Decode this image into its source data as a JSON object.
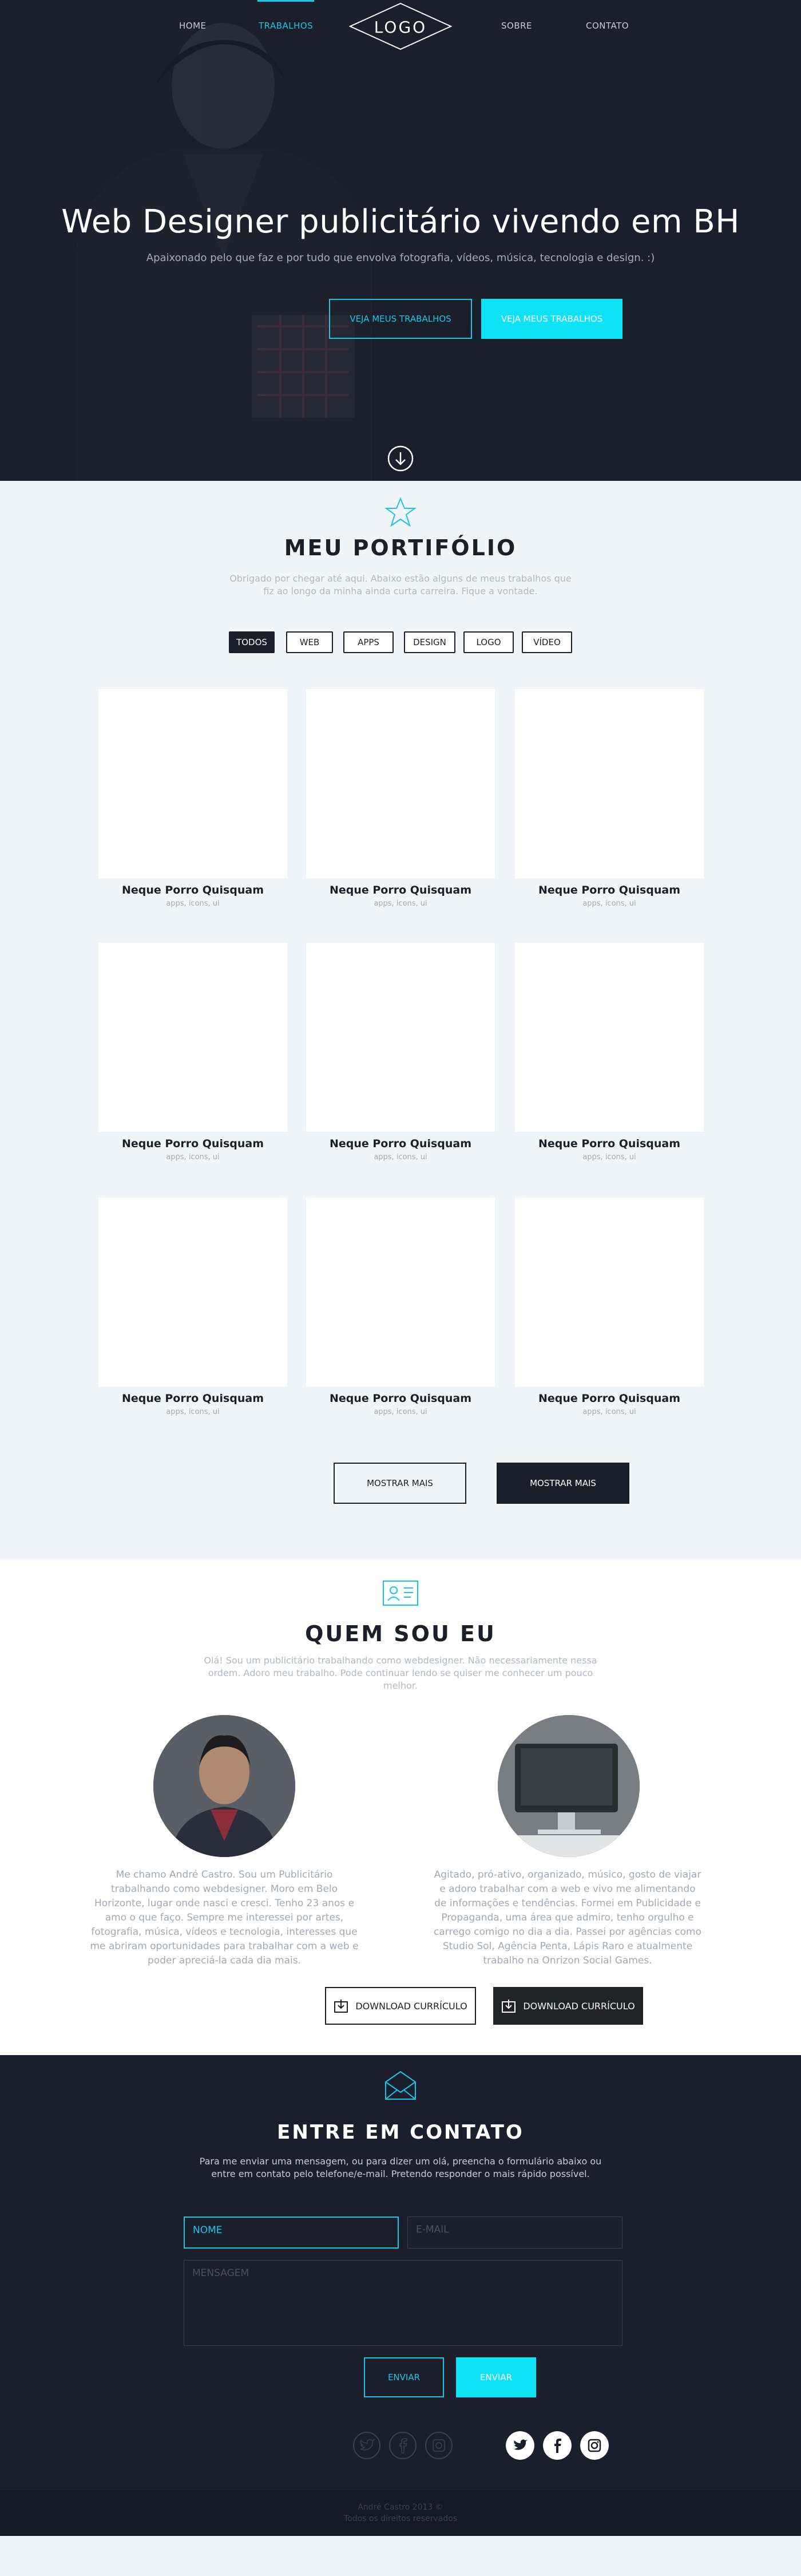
{
  "nav": {
    "items": [
      "HOME",
      "TRABALHOS",
      "SOBRE",
      "CONTATO"
    ],
    "logo": "LOGO"
  },
  "hero": {
    "title": "Web Designer publicitário vivendo em BH",
    "subtitle": "Apaixonado pelo que faz e por tudo que envolva fotografia, vídeos, música, tecnologia e design. :)",
    "button_outline": "VEJA MEUS TRABALHOS",
    "button_filled": "VEJA MEUS TRABALHOS"
  },
  "portfolio": {
    "title": "MEU PORTIFÓLIO",
    "subtitle": "Obrigado por chegar até aqui. Abaixo estão alguns de meus trabalhos que fiz ao longo da minha ainda curta carreira. Fique a vontade.",
    "filters": [
      "TODOS",
      "WEB",
      "APPS",
      "DESIGN",
      "LOGO",
      "VÍDEO"
    ],
    "items": [
      {
        "name": "Neque Porro Quisquam",
        "tags": "apps, icons, ui"
      },
      {
        "name": "Neque Porro Quisquam",
        "tags": "apps, icons, ui"
      },
      {
        "name": "Neque Porro Quisquam",
        "tags": "apps, icons, ui"
      },
      {
        "name": "Neque Porro Quisquam",
        "tags": "apps, icons, ui"
      },
      {
        "name": "Neque Porro Quisquam",
        "tags": "apps, icons, ui"
      },
      {
        "name": "Neque Porro Quisquam",
        "tags": "apps, icons, ui"
      },
      {
        "name": "Neque Porro Quisquam",
        "tags": "apps, icons, ui"
      },
      {
        "name": "Neque Porro Quisquam",
        "tags": "apps, icons, ui"
      },
      {
        "name": "Neque Porro Quisquam",
        "tags": "apps, icons, ui"
      }
    ],
    "more_outline": "MOSTRAR MAIS",
    "more_filled": "MOSTRAR MAIS"
  },
  "about": {
    "title": "QUEM SOU EU",
    "subtitle": "Olá! Sou um publicitário trabalhando como webdesigner. Não necessariamente nessa ordem. Adoro meu trabalho. Pode continuar lendo se quiser me conhecer um pouco melhor.",
    "left_text": "Me chamo André Castro. Sou um Publicitário trabalhando como webdesigner. Moro em Belo Horizonte, lugar onde nasci e cresci. Tenho 23 anos e amo o que faço. Sempre me interessei por artes, fotografia, música, vídeos e tecnologia, interesses que me abriram oportunidades para trabalhar com a web e poder apreciá-la cada dia mais.",
    "right_text": "Agitado, pró-ativo, organizado, músico, gosto de viajar e adoro trabalhar com a web e vivo me alimentando de informações e tendências. Formei em Publicidade e Propaganda, uma área que admiro, tenho orgulho e carrego comigo no dia a dia. Passei por agências como Studio Sol, Agência Penta, Lápis Raro e atualmente trabalho na Onrizon Social Games.",
    "download_outline": "DOWNLOAD CURRÍCULO",
    "download_filled": "DOWNLOAD CURRÍCULO"
  },
  "contact": {
    "title": "ENTRE EM CONTATO",
    "subtitle": "Para me enviar uma mensagem, ou para dizer um olá, preencha o formulário abaixo ou entre em contato pelo telefone/e-mail. Pretendo responder o mais rápido possível.",
    "name_placeholder": "NOME",
    "email_placeholder": "E-MAIL",
    "message_placeholder": "MENSAGEM",
    "send_outline": "ENVIAR",
    "send_filled": "ENVIAR"
  },
  "footer": {
    "line1": "André Castro 2013 ©",
    "line2": "Todos os direitos reservados"
  },
  "colors": {
    "accent": "#19c6e6",
    "accent_bright": "#0ee2f5",
    "dark": "#1b1f2b",
    "light_bg": "#f1f4f8"
  }
}
